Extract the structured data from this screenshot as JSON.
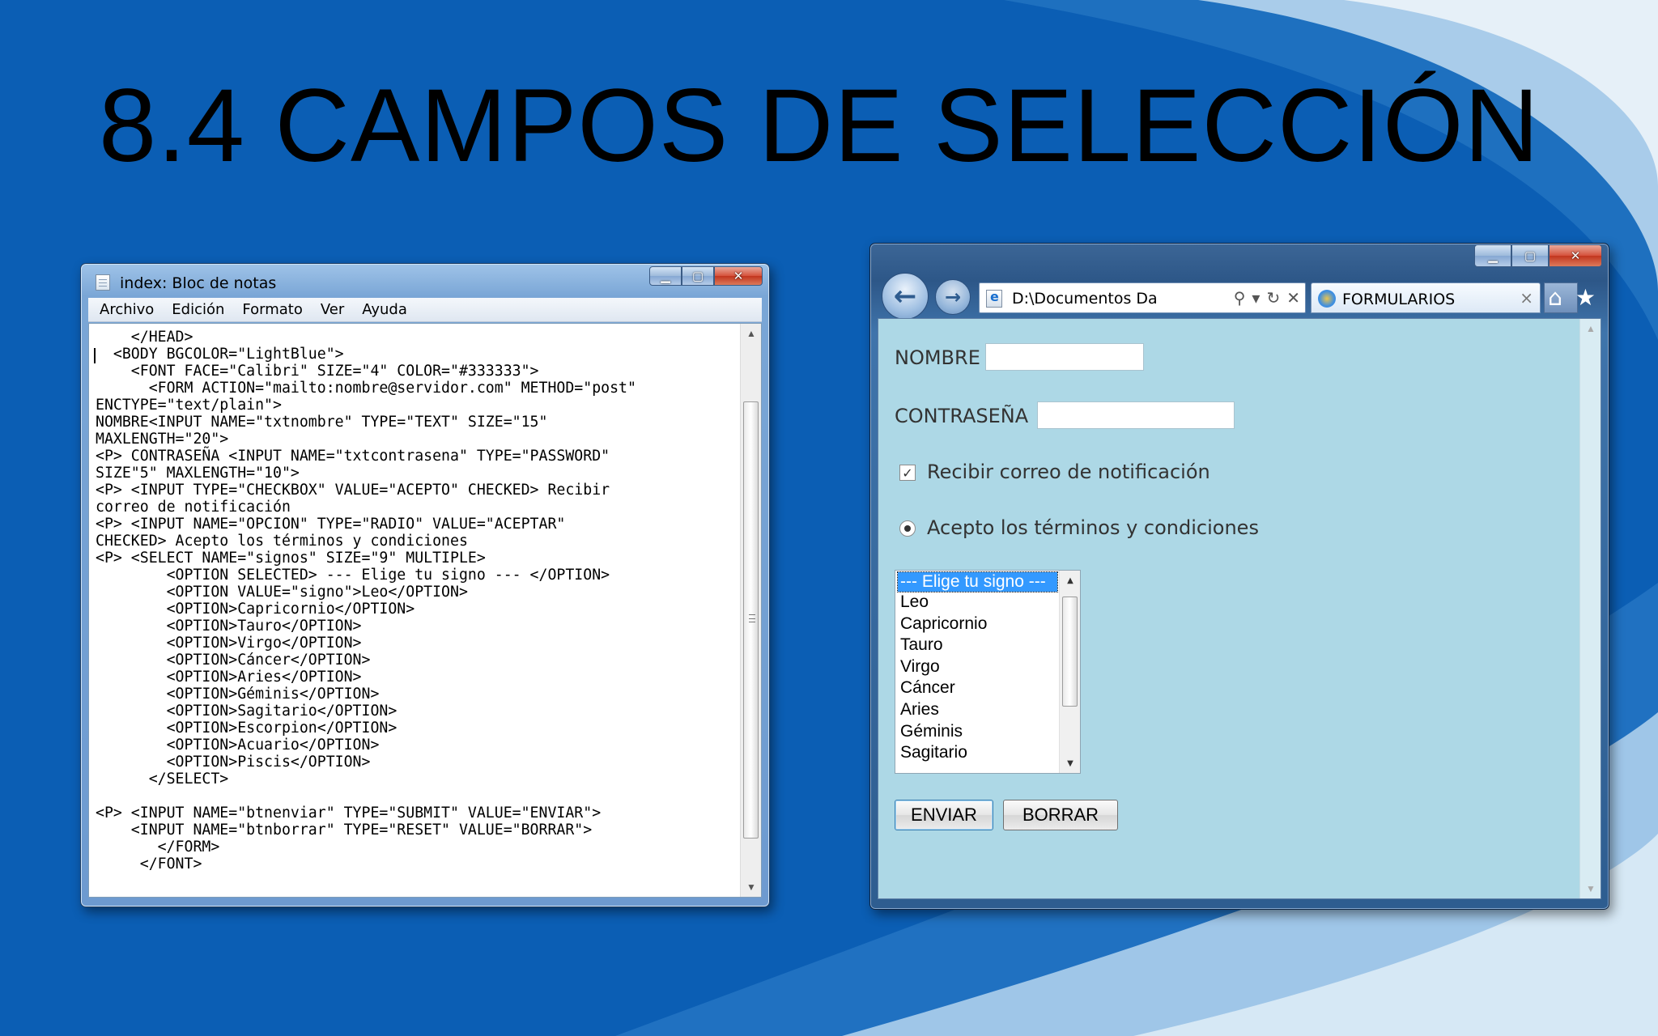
{
  "slide": {
    "title": "8.4 CAMPOS DE SELECCIÓN",
    "background_color": "#0b5eb4"
  },
  "notepad": {
    "title": "index: Bloc de notas",
    "menu": [
      "Archivo",
      "Edición",
      "Formato",
      "Ver",
      "Ayuda"
    ],
    "code": "    </HEAD>\n  <BODY BGCOLOR=\"LightBlue\">\n    <FONT FACE=\"Calibri\" SIZE=\"4\" COLOR=\"#333333\">\n      <FORM ACTION=\"mailto:nombre@servidor.com\" METHOD=\"post\"\nENCTYPE=\"text/plain\">\nNOMBRE<INPUT NAME=\"txtnombre\" TYPE=\"TEXT\" SIZE=\"15\"\nMAXLENGTH=\"20\">\n<P> CONTRASEÑA <INPUT NAME=\"txtcontrasena\" TYPE=\"PASSWORD\"\nSIZE\"5\" MAXLENGTH=\"10\">\n<P> <INPUT TYPE=\"CHECKBOX\" VALUE=\"ACEPTO\" CHECKED> Recibir\ncorreo de notificación\n<P> <INPUT NAME=\"OPCION\" TYPE=\"RADIO\" VALUE=\"ACEPTAR\"\nCHECKED> Acepto los términos y condiciones\n<P> <SELECT NAME=\"signos\" SIZE=\"9\" MULTIPLE>\n        <OPTION SELECTED> --- Elige tu signo --- </OPTION>\n        <OPTION VALUE=\"signo\">Leo</OPTION>\n        <OPTION>Capricornio</OPTION>\n        <OPTION>Tauro</OPTION>\n        <OPTION>Virgo</OPTION>\n        <OPTION>Cáncer</OPTION>\n        <OPTION>Aries</OPTION>\n        <OPTION>Géminis</OPTION>\n        <OPTION>Sagitario</OPTION>\n        <OPTION>Escorpion</OPTION>\n        <OPTION>Acuario</OPTION>\n        <OPTION>Piscis</OPTION>\n      </SELECT>\n\n<P> <INPUT NAME=\"btnenviar\" TYPE=\"SUBMIT\" VALUE=\"ENVIAR\">\n    <INPUT NAME=\"btnborrar\" TYPE=\"RESET\" VALUE=\"BORRAR\">\n       </FORM>\n     </FONT>"
  },
  "browser": {
    "address": "D:\\Documentos Da",
    "address_tools": [
      "⚲",
      "▾",
      "↻",
      "✕"
    ],
    "tab_label": "FORMULARIOS",
    "tab_close": "×",
    "toolbar_icons": [
      "home-icon",
      "favorites-star-icon"
    ],
    "viewport_background": "#add8e6",
    "form": {
      "nombre_label": "NOMBRE",
      "nombre_value": "",
      "contrasena_label": "CONTRASEÑA",
      "contrasena_value": "",
      "checkbox_label": "Recibir correo de notificación",
      "checkbox_checked": true,
      "radio_label": "Acepto los términos y condiciones",
      "radio_checked": true,
      "select_options": [
        "--- Elige tu signo ---",
        "Leo",
        "Capricornio",
        "Tauro",
        "Virgo",
        "Cáncer",
        "Aries",
        "Géminis",
        "Sagitario"
      ],
      "selected_option": "--- Elige tu signo ---",
      "submit_label": "ENVIAR",
      "reset_label": "BORRAR"
    }
  }
}
